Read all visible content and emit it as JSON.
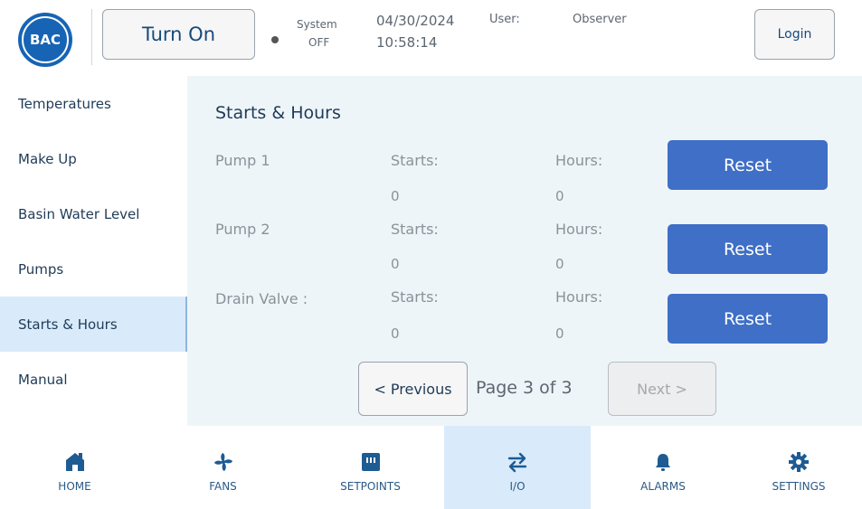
{
  "header": {
    "logo_text": "BAC",
    "turn_on_label": "Turn On",
    "system_label": "System",
    "system_state": "OFF",
    "date": "04/30/2024",
    "time": "10:58:14",
    "user_label": "User:",
    "user_name": "Observer",
    "login_label": "Login"
  },
  "sidebar": {
    "items": [
      {
        "label": "Temperatures"
      },
      {
        "label": "Make Up"
      },
      {
        "label": "Basin Water Level"
      },
      {
        "label": "Pumps"
      },
      {
        "label": "Starts & Hours",
        "active": true
      },
      {
        "label": "Manual"
      }
    ]
  },
  "main": {
    "title": "Starts & Hours",
    "rows": [
      {
        "name": "Pump 1",
        "starts_label": "Starts:",
        "starts_value": "0",
        "hours_label": "Hours:",
        "hours_value": "0",
        "reset_label": "Reset"
      },
      {
        "name": "Pump 2",
        "starts_label": "Starts:",
        "starts_value": "0",
        "hours_label": "Hours:",
        "hours_value": "0",
        "reset_label": "Reset"
      },
      {
        "name": "Drain Valve :",
        "starts_label": "Starts:",
        "starts_value": "0",
        "hours_label": "Hours:",
        "hours_value": "0",
        "reset_label": "Reset"
      }
    ],
    "pagination": {
      "previous_label": "< Previous",
      "page_indicator": "Page 3 of 3",
      "next_label": "Next >"
    }
  },
  "nav": {
    "items": [
      {
        "label": "HOME",
        "icon": "home-icon"
      },
      {
        "label": "FANS",
        "icon": "fan-icon"
      },
      {
        "label": "SETPOINTS",
        "icon": "setpoints-icon"
      },
      {
        "label": "I/O",
        "icon": "swap-arrows-icon",
        "active": true
      },
      {
        "label": "ALARMS",
        "icon": "bell-icon"
      },
      {
        "label": "SETTINGS",
        "icon": "gear-icon"
      }
    ]
  },
  "colors": {
    "accent": "#3f6fc6",
    "active_bg": "#d9ebfb",
    "panel_bg": "#eef5f9",
    "brand": "#1764b4"
  }
}
